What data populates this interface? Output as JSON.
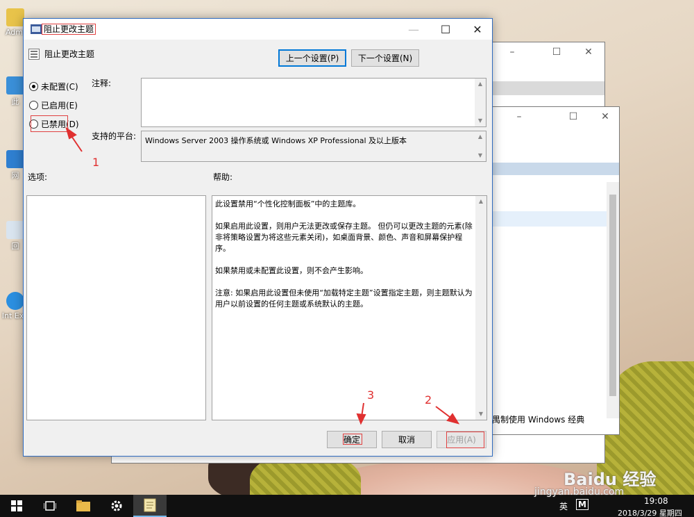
{
  "desktop": {
    "icons": [
      {
        "label": "Admi"
      },
      {
        "label": "此"
      },
      {
        "label": "网"
      },
      {
        "label": "回"
      },
      {
        "label": "Int Exp"
      }
    ]
  },
  "background_window": {
    "partial_text": "禺制使用 Windows 经典"
  },
  "dialog": {
    "title": "阻止更改主题",
    "header_title": "阻止更改主题",
    "prev_button": "上一个设置(P)",
    "next_button": "下一个设置(N)",
    "radios": [
      {
        "label": "未配置(C)",
        "checked": true
      },
      {
        "label": "已启用(E)",
        "checked": false
      },
      {
        "label": "已禁用(D)",
        "checked": false
      }
    ],
    "comment_label": "注释:",
    "comment_value": "",
    "platform_label": "支持的平台:",
    "platform_value": "Windows Server 2003 操作系统或 Windows XP Professional 及以上版本",
    "options_label": "选项:",
    "help_label": "帮助:",
    "help_paragraphs": [
      "此设置禁用“个性化控制面板”中的主题库。",
      "如果启用此设置，则用户无法更改或保存主题。 但仍可以更改主题的元素(除非将策略设置为将这些元素关闭)，如桌面背景、颜色、声音和屏幕保护程序。",
      "如果禁用或未配置此设置，则不会产生影响。",
      "注意: 如果启用此设置但未使用“加载特定主题”设置指定主题，则主题默认为用户以前设置的任何主题或系统默认的主题。"
    ],
    "ok_button": "确定",
    "cancel_button": "取消",
    "apply_button": "应用(A)"
  },
  "annotations": {
    "one": "1",
    "two": "2",
    "three": "3"
  },
  "taskbar": {
    "time": "19:08",
    "date": "2018/3/29 星期四",
    "ime": "英",
    "ime_mode": "M",
    "watermark_brand": "Baidu 经验",
    "watermark_url": "jingyan.baidu.com"
  },
  "colors": {
    "accent": "#0078d7",
    "annotation": "#e03030",
    "taskbar": "#101010"
  }
}
